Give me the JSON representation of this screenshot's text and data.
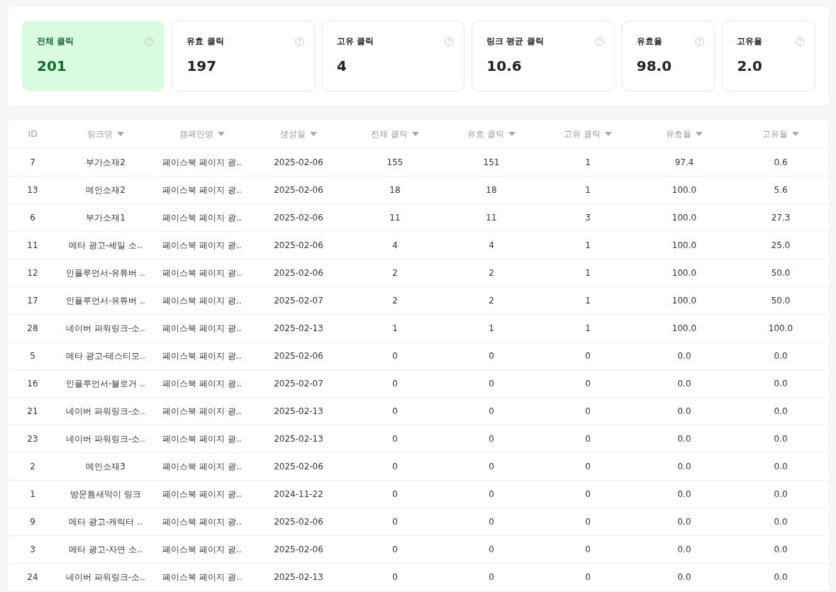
{
  "stats": [
    {
      "label": "전체 클릭",
      "value": "201",
      "selected": true,
      "kind": "wide"
    },
    {
      "label": "유효 클릭",
      "value": "197",
      "selected": false,
      "kind": "wide"
    },
    {
      "label": "고유 클릭",
      "value": "4",
      "selected": false,
      "kind": "wide"
    },
    {
      "label": "링크 평균 클릭",
      "value": "10.6",
      "selected": false,
      "kind": "wide"
    },
    {
      "label": "유효율",
      "value": "98.0",
      "selected": false,
      "kind": "narrow"
    },
    {
      "label": "고유율",
      "value": "2.0",
      "selected": false,
      "kind": "narrow"
    }
  ],
  "table": {
    "columns": [
      {
        "label": "ID",
        "sortable": false
      },
      {
        "label": "링크명",
        "sortable": true
      },
      {
        "label": "캠페인명",
        "sortable": true
      },
      {
        "label": "생성일",
        "sortable": true
      },
      {
        "label": "전체 클릭",
        "sortable": true
      },
      {
        "label": "유효 클릭",
        "sortable": true
      },
      {
        "label": "고유 클릭",
        "sortable": true
      },
      {
        "label": "유효율",
        "sortable": true
      },
      {
        "label": "고유율",
        "sortable": true
      }
    ],
    "rows": [
      [
        "7",
        "부가소재2",
        "페이스북 페이지 광..",
        "2025-02-06",
        "155",
        "151",
        "1",
        "97.4",
        "0.6"
      ],
      [
        "13",
        "메인소재2",
        "페이스북 페이지 광..",
        "2025-02-06",
        "18",
        "18",
        "1",
        "100.0",
        "5.6"
      ],
      [
        "6",
        "부가소재1",
        "페이스북 페이지 광..",
        "2025-02-06",
        "11",
        "11",
        "3",
        "100.0",
        "27.3"
      ],
      [
        "11",
        "메타 광고-세일 소..",
        "페이스북 페이지 광..",
        "2025-02-06",
        "4",
        "4",
        "1",
        "100.0",
        "25.0"
      ],
      [
        "12",
        "인플루언서-유튜버 ..",
        "페이스북 페이지 광..",
        "2025-02-06",
        "2",
        "2",
        "1",
        "100.0",
        "50.0"
      ],
      [
        "17",
        "인플루언서-유튜버 ..",
        "페이스북 페이지 광..",
        "2025-02-07",
        "2",
        "2",
        "1",
        "100.0",
        "50.0"
      ],
      [
        "28",
        "네이버 파워링크-소..",
        "페이스북 페이지 광..",
        "2025-02-13",
        "1",
        "1",
        "1",
        "100.0",
        "100.0"
      ],
      [
        "5",
        "메타 광고-테스티모..",
        "페이스북 페이지 광..",
        "2025-02-06",
        "0",
        "0",
        "0",
        "0.0",
        "0.0"
      ],
      [
        "16",
        "인플루언서-블로거 ..",
        "페이스북 페이지 광..",
        "2025-02-07",
        "0",
        "0",
        "0",
        "0.0",
        "0.0"
      ],
      [
        "21",
        "네이버 파워링크-소..",
        "페이스북 페이지 광..",
        "2025-02-13",
        "0",
        "0",
        "0",
        "0.0",
        "0.0"
      ],
      [
        "23",
        "네이버 파워링크-소..",
        "페이스북 페이지 광..",
        "2025-02-13",
        "0",
        "0",
        "0",
        "0.0",
        "0.0"
      ],
      [
        "2",
        "메인소재3",
        "페이스북 페이지 광..",
        "2025-02-06",
        "0",
        "0",
        "0",
        "0.0",
        "0.0"
      ],
      [
        "1",
        "방문틈새막이 링크",
        "페이스북 페이지 광..",
        "2024-11-22",
        "0",
        "0",
        "0",
        "0.0",
        "0.0"
      ],
      [
        "9",
        "메타 광고-캐릭터 ..",
        "페이스북 페이지 광..",
        "2025-02-06",
        "0",
        "0",
        "0",
        "0.0",
        "0.0"
      ],
      [
        "3",
        "메타 광고-자연 소..",
        "페이스북 페이지 광..",
        "2025-02-06",
        "0",
        "0",
        "0",
        "0.0",
        "0.0"
      ],
      [
        "24",
        "네이버 파워링크-소..",
        "페이스북 페이지 광..",
        "2025-02-13",
        "0",
        "0",
        "0",
        "0.0",
        "0.0"
      ]
    ]
  }
}
